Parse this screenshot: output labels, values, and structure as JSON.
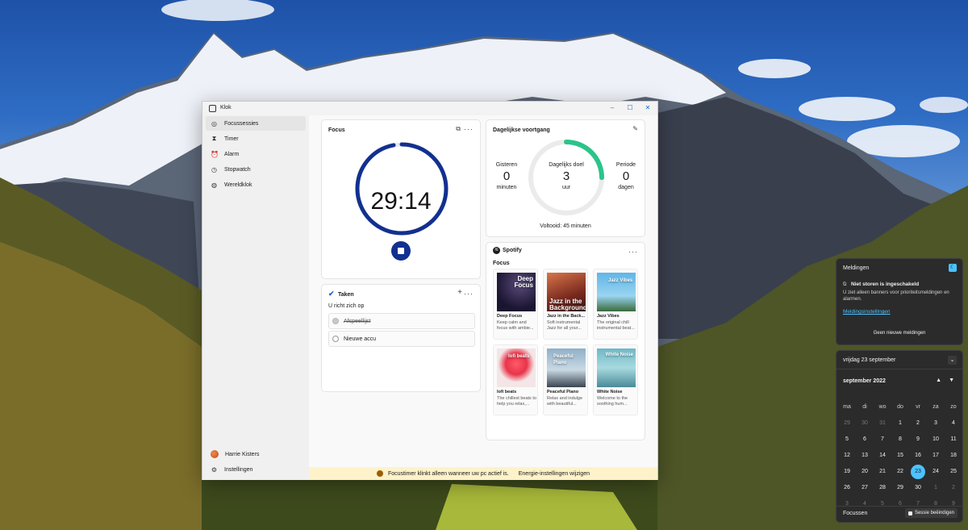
{
  "window": {
    "title": "Klok",
    "controls": [
      "–",
      "☐",
      "✕"
    ]
  },
  "sidebar": {
    "items": [
      {
        "label": "Focussessies",
        "icon": "focus-icon",
        "active": true
      },
      {
        "label": "Timer",
        "icon": "hourglass-icon"
      },
      {
        "label": "Alarm",
        "icon": "alarm-icon"
      },
      {
        "label": "Stopwatch",
        "icon": "stopwatch-icon"
      },
      {
        "label": "Wereldklok",
        "icon": "globe-icon"
      }
    ],
    "user": "Harrie Kisters",
    "settings": "Instellingen"
  },
  "focus": {
    "title": "Focus",
    "time": "29:14",
    "progress": 0.97
  },
  "tasks": {
    "title": "Taken",
    "subtitle": "U richt zich op",
    "items": [
      {
        "text": "Afspeellijst",
        "done": true
      },
      {
        "text": "Nieuwe accu",
        "done": false
      }
    ]
  },
  "daily": {
    "title": "Dagelijkse voortgang",
    "yesterday_label": "Gisteren",
    "yesterday_value": "0",
    "yesterday_unit": "minuten",
    "goal_label": "Dagelijks doel",
    "goal_value": "3",
    "goal_unit": "uur",
    "streak_label": "Periode",
    "streak_value": "0",
    "streak_unit": "dagen",
    "completed": "Voltooid: 45 minuten",
    "progress": 0.25,
    "colors": {
      "progress": "#2bc48a",
      "track": "#ebebeb"
    }
  },
  "spotify": {
    "brand": "Spotify",
    "section": "Focus",
    "playlists": [
      {
        "name": "Deep Focus",
        "art_text": "Deep Focus",
        "desc": "Keep calm and focus with ambie..."
      },
      {
        "name": "Jazz in the Back...",
        "art_text": "Jazz in the Background",
        "desc": "Soft instrumental Jazz for all your..."
      },
      {
        "name": "Jazz Vibes",
        "art_text": "Jazz Vibes",
        "desc": "The original chill instrumental beat..."
      },
      {
        "name": "lofi beats",
        "art_text": "lofi beats",
        "desc": "The chillest beats to help you relax,..."
      },
      {
        "name": "Peaceful Piano",
        "art_text": "Peaceful Piano",
        "desc": "Relax and indulge with beautiful..."
      },
      {
        "name": "White Noise",
        "art_text": "White Noise",
        "desc": "Welcome to the soothing hum..."
      }
    ]
  },
  "banner": {
    "text": "Focustimer klinkt alleen wanneer uw pc actief is.",
    "link": "Energie-instellingen wijzigen"
  },
  "notifications": {
    "title": "Meldingen",
    "dnd_title": "Niet storen is ingeschakeld",
    "dnd_desc": "U ziet alleen banners voor prioriteitsmeldingen en alarmen.",
    "settings_link": "Meldingsinstellingen",
    "empty": "Geen nieuwe meldingen"
  },
  "calendar": {
    "date_header": "vrijdag 23 september",
    "month": "september 2022",
    "weekdays": [
      "ma",
      "di",
      "wo",
      "do",
      "vr",
      "za",
      "zo"
    ],
    "days": [
      [
        "29",
        "30",
        "31",
        "1",
        "2",
        "3",
        "4"
      ],
      [
        "5",
        "6",
        "7",
        "8",
        "9",
        "10",
        "11"
      ],
      [
        "12",
        "13",
        "14",
        "15",
        "16",
        "17",
        "18"
      ],
      [
        "19",
        "20",
        "21",
        "22",
        "23",
        "24",
        "25"
      ],
      [
        "26",
        "27",
        "28",
        "29",
        "30",
        "1",
        "2"
      ],
      [
        "3",
        "4",
        "5",
        "6",
        "7",
        "8",
        "9"
      ]
    ],
    "today": "23",
    "focus_label": "Focussen",
    "end_session": "Sessie beëindigen",
    "colors": {
      "accent": "#4cc2ff"
    }
  },
  "colors": {
    "focus_ring": "#12308f",
    "banner_bg": "#fdf2c9",
    "link_blue": "#4cc2ff"
  }
}
